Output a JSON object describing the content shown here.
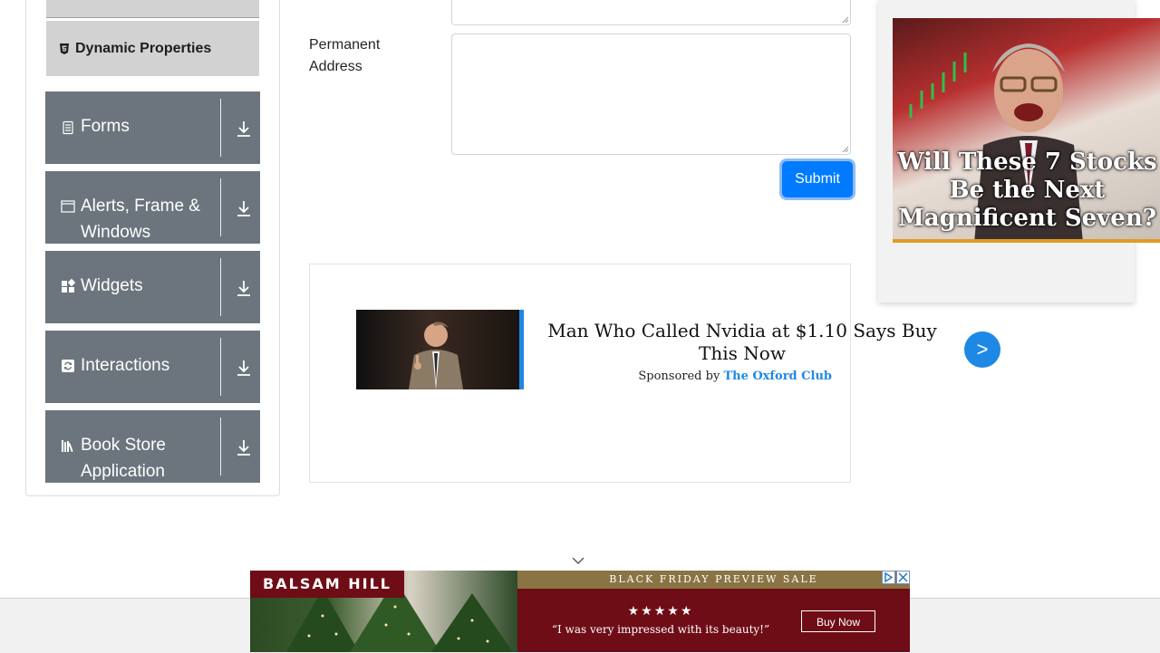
{
  "sidebar": {
    "elements_sub_item": {
      "label": "Dynamic Properties",
      "icon": "html5-shield-icon"
    },
    "categories": [
      {
        "label": "Forms",
        "icon": "form-doc-icon"
      },
      {
        "label": "Alerts, Frame & Windows",
        "icon": "window-icon"
      },
      {
        "label": "Widgets",
        "icon": "widgets-icon"
      },
      {
        "label": "Interactions",
        "icon": "interactions-icon"
      },
      {
        "label": "Book Store Application",
        "icon": "books-icon"
      }
    ]
  },
  "form": {
    "permanent_address_label": "Permanent Address",
    "permanent_address_value": "",
    "submit_label": "Submit"
  },
  "ads": {
    "middle": {
      "headline": "Man Who Called Nvidia at $1.10 Says Buy This Now",
      "sponsored_prefix": "Sponsored by",
      "sponsor": "The Oxford Club",
      "next_label": ">"
    },
    "right": {
      "headline": "Will These 7 Stocks Be the Next Magnificent Seven?"
    },
    "bottom": {
      "brand": "BALSAM HILL",
      "banner": "BLACK FRIDAY PREVIEW SALE",
      "stars": "★★★★★",
      "quote": "“I was very impressed with its beauty!”",
      "cta": "Buy Now"
    }
  },
  "colors": {
    "category_bg": "#6c757d",
    "sub_item_bg": "#d2d2d2",
    "submit_bg": "#007bff",
    "ad_accent": "#1e88e5",
    "bottom_ad_bg": "#6e0d16"
  }
}
